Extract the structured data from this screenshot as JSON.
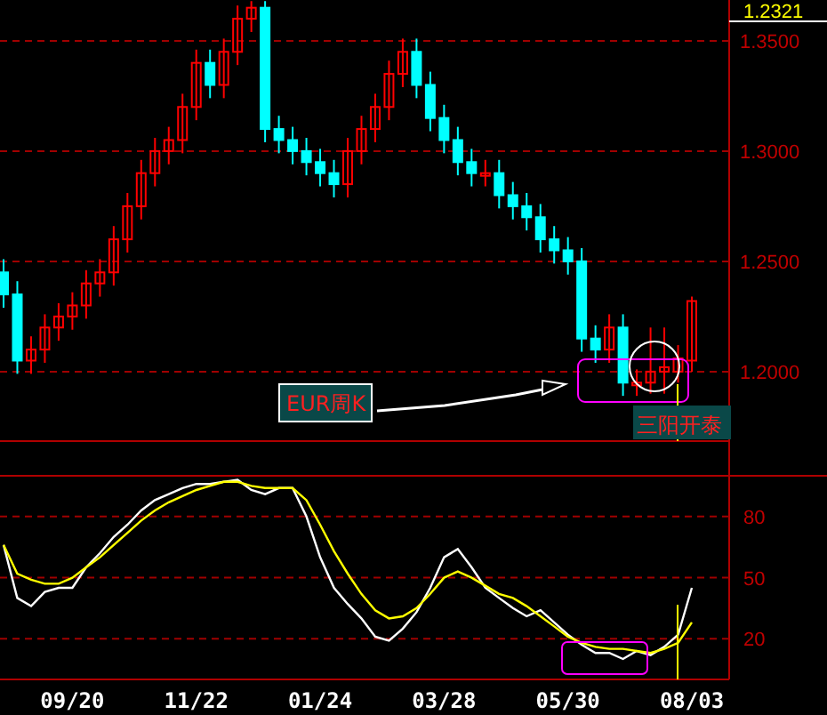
{
  "price_panel": {
    "last_price": "1.2321",
    "chart_data": {
      "type": "candlestick",
      "categories": [
        null,
        null,
        null,
        null,
        null,
        null,
        null,
        null,
        null,
        null,
        null,
        null,
        null,
        null,
        null,
        null,
        null,
        null,
        null,
        null,
        null,
        null,
        null,
        null,
        null,
        null,
        null,
        null,
        null,
        null,
        null,
        null,
        null,
        null,
        null,
        null,
        null,
        null,
        null,
        null,
        null,
        null,
        null,
        null,
        null,
        null,
        null,
        null,
        null,
        null,
        null
      ],
      "grid": true,
      "ohlc": [
        [
          1.245,
          1.251,
          1.229,
          1.235
        ],
        [
          1.235,
          1.241,
          1.199,
          1.205
        ],
        [
          1.205,
          1.216,
          1.199,
          1.21
        ],
        [
          1.21,
          1.226,
          1.204,
          1.22
        ],
        [
          1.22,
          1.231,
          1.214,
          1.225
        ],
        [
          1.225,
          1.236,
          1.219,
          1.23
        ],
        [
          1.23,
          1.246,
          1.224,
          1.24
        ],
        [
          1.24,
          1.251,
          1.234,
          1.245
        ],
        [
          1.245,
          1.266,
          1.239,
          1.26
        ],
        [
          1.26,
          1.281,
          1.254,
          1.275
        ],
        [
          1.275,
          1.296,
          1.269,
          1.29
        ],
        [
          1.29,
          1.306,
          1.284,
          1.3
        ],
        [
          1.3,
          1.311,
          1.294,
          1.305
        ],
        [
          1.305,
          1.326,
          1.299,
          1.32
        ],
        [
          1.32,
          1.346,
          1.314,
          1.34
        ],
        [
          1.34,
          1.346,
          1.324,
          1.33
        ],
        [
          1.33,
          1.351,
          1.324,
          1.345
        ],
        [
          1.345,
          1.366,
          1.339,
          1.36
        ],
        [
          1.36,
          1.368,
          1.354,
          1.365
        ],
        [
          1.365,
          1.368,
          1.304,
          1.31
        ],
        [
          1.31,
          1.316,
          1.299,
          1.305
        ],
        [
          1.305,
          1.311,
          1.294,
          1.3
        ],
        [
          1.3,
          1.306,
          1.289,
          1.295
        ],
        [
          1.295,
          1.301,
          1.284,
          1.29
        ],
        [
          1.29,
          1.296,
          1.279,
          1.285
        ],
        [
          1.285,
          1.306,
          1.279,
          1.3
        ],
        [
          1.3,
          1.316,
          1.294,
          1.31
        ],
        [
          1.31,
          1.326,
          1.304,
          1.32
        ],
        [
          1.32,
          1.341,
          1.314,
          1.335
        ],
        [
          1.335,
          1.351,
          1.329,
          1.345
        ],
        [
          1.345,
          1.351,
          1.324,
          1.33
        ],
        [
          1.33,
          1.336,
          1.309,
          1.315
        ],
        [
          1.315,
          1.321,
          1.299,
          1.305
        ],
        [
          1.305,
          1.311,
          1.289,
          1.295
        ],
        [
          1.295,
          1.301,
          1.284,
          1.29
        ],
        [
          1.29,
          1.296,
          1.284,
          1.29
        ],
        [
          1.29,
          1.296,
          1.274,
          1.28
        ],
        [
          1.28,
          1.286,
          1.269,
          1.275
        ],
        [
          1.275,
          1.281,
          1.264,
          1.27
        ],
        [
          1.27,
          1.276,
          1.254,
          1.26
        ],
        [
          1.26,
          1.266,
          1.249,
          1.255
        ],
        [
          1.255,
          1.261,
          1.244,
          1.25
        ],
        [
          1.25,
          1.256,
          1.209,
          1.215
        ],
        [
          1.215,
          1.221,
          1.204,
          1.21
        ],
        [
          1.21,
          1.226,
          1.204,
          1.22
        ],
        [
          1.22,
          1.226,
          1.189,
          1.195
        ],
        [
          1.195,
          1.201,
          1.189,
          1.195
        ],
        [
          1.195,
          1.22,
          1.19,
          1.2
        ],
        [
          1.2,
          1.22,
          1.19,
          1.202
        ],
        [
          1.2,
          1.212,
          1.195,
          1.206
        ],
        [
          1.205,
          1.234,
          1.2,
          1.232
        ]
      ],
      "ylim": [
        1.1685,
        1.3685
      ],
      "yticks": [
        {
          "value": 1.35,
          "label": "1.3500"
        },
        {
          "value": 1.3,
          "label": "1.3000"
        },
        {
          "value": 1.25,
          "label": "1.2500"
        },
        {
          "value": 1.2,
          "label": "1.2000"
        }
      ]
    },
    "annotations": [
      {
        "kind": "callout",
        "text": "EUR周K"
      },
      {
        "kind": "tag",
        "text": "三阳开泰"
      }
    ]
  },
  "oscillator_panel": {
    "chart_data": {
      "type": "line",
      "categories": [
        null,
        null,
        null,
        null,
        null,
        "09/20",
        null,
        null,
        null,
        null,
        null,
        null,
        null,
        null,
        "11/22",
        null,
        null,
        null,
        null,
        null,
        null,
        null,
        null,
        "01/24",
        null,
        null,
        null,
        null,
        null,
        null,
        null,
        null,
        "03/28",
        null,
        null,
        null,
        null,
        null,
        null,
        null,
        null,
        "05/30",
        null,
        null,
        null,
        null,
        null,
        null,
        null,
        null,
        "08/03"
      ],
      "series": [
        {
          "color": "#ffffff",
          "values": [
            66,
            40,
            36,
            43,
            45,
            45,
            55,
            62,
            70,
            76,
            83,
            88,
            91,
            94,
            96,
            96,
            97,
            98,
            93,
            91,
            94,
            94,
            80,
            60,
            45,
            37,
            30,
            21,
            19,
            25,
            33,
            45,
            60,
            64,
            55,
            45,
            40,
            35,
            31,
            34,
            28,
            22,
            17,
            13,
            13,
            10,
            14,
            12,
            16,
            22,
            45
          ]
        },
        {
          "color": "#ffff00",
          "values": [
            66,
            52,
            49,
            47,
            47,
            50,
            55,
            60,
            66,
            72,
            78,
            83,
            87,
            90,
            93,
            95,
            97,
            97,
            95,
            94,
            94,
            94,
            88,
            76,
            63,
            52,
            42,
            34,
            30,
            31,
            35,
            42,
            50,
            53,
            50,
            46,
            42,
            40,
            36,
            31,
            26,
            21,
            18,
            16,
            15,
            15,
            14,
            13,
            15,
            18,
            28
          ]
        }
      ],
      "ylim": [
        0,
        100
      ],
      "yticks": [
        20,
        50,
        80
      ],
      "grid": true
    }
  }
}
